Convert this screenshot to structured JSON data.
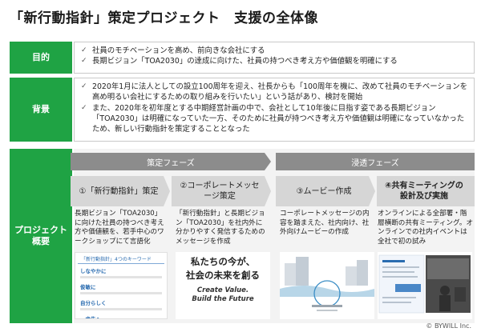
{
  "title": "「新行動指針」策定プロジェクト　支援の全体像",
  "labels": {
    "purpose": "目的",
    "background": "背景",
    "overview_line1": "プロジェクト",
    "overview_line2": "概要"
  },
  "purpose": [
    "社員のモチベーションを高め、前向きな会社にする",
    "長期ビジョン「TOA2030」の達成に向けた、社員の持つべき考え方や価値観を明確にする"
  ],
  "background": [
    "2020年1月に法人としての設立100周年を迎え、社長からも「100周年を機に、改めて社員のモチベーションを高め明るい会社にするための取り組みを行いたい」という話があり、検討を開始",
    "また、2020年を初年度とする中期経営計画の中で、会社として10年後に目指す姿である長期ビジョン「TOA2030」は明確になっていた一方、そのために社員が持つべき考え方や価値観は明確になっていなかったため、新しい行動指針を策定することとなった"
  ],
  "phases": {
    "a": "策定フェーズ",
    "b": "浸透フェーズ"
  },
  "steps": [
    {
      "title": "①「新行動指針」策定",
      "desc": "長期ビジョン「TOA2030」に向けた社員の持つべき考え方や価値観を、若手中心のワークショップにて言語化"
    },
    {
      "title": "②コーポレートメッセージ策定",
      "desc": "「新行動指針」と長期ビジョン「TOA2030」を社内外に分かりやすく発信するためのメッセージを作成"
    },
    {
      "title": "③ムービー作成",
      "desc": "コーポレートメッセージの内容を踏まえた、社内向け、社外向けムービーの作成"
    },
    {
      "title": "④共有ミーティングの設計及び実施",
      "desc": "オンラインによる全部署・階層横断の共有ミーティング。オンラインでの社内イベントは全社で初の試み"
    }
  ],
  "thumb1": {
    "header": "「新行動指針」4つのキーワード",
    "keywords": [
      "しなやかに",
      "俊敏に",
      "自分らしく",
      "一歩先へ"
    ]
  },
  "thumb2": {
    "jp_line1": "私たちの今が、",
    "jp_line2": "社会の未来を創る",
    "en_line1": "Create Value.",
    "en_line2": "Build the Future"
  },
  "copyright": "© BYWILL Inc.",
  "colors": {
    "accent": "#1fa344",
    "phase": "#8c8c8c",
    "step": "#d6d6d6",
    "panel": "#f3f3f3"
  },
  "icons": {
    "bullet": "check-icon"
  }
}
